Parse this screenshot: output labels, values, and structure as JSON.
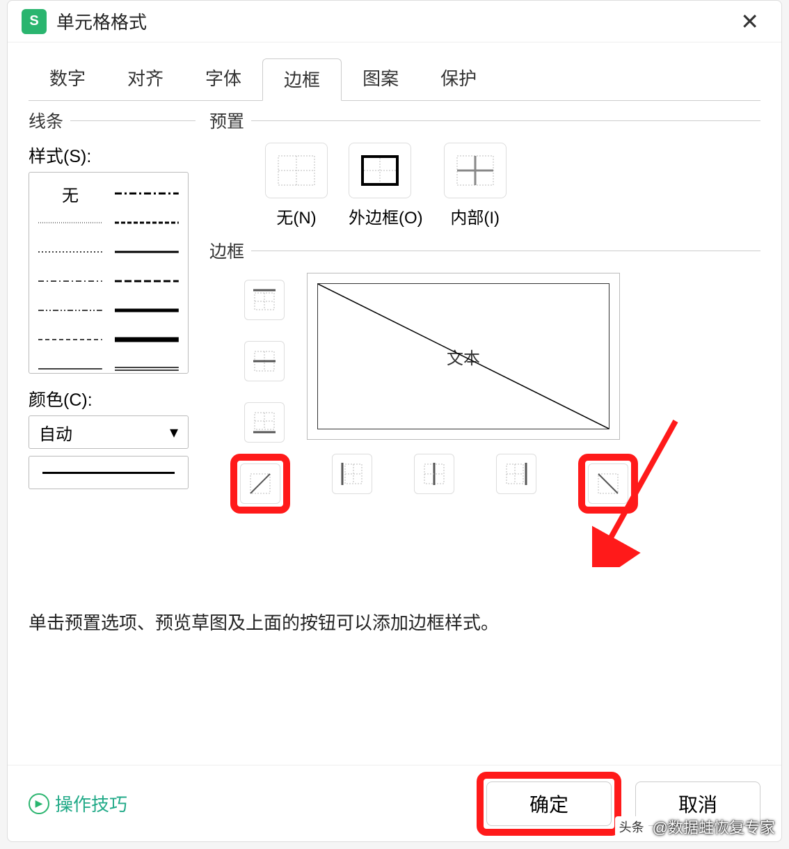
{
  "dialog": {
    "title": "单元格格式",
    "app_icon_letter": "S"
  },
  "tabs": [
    "数字",
    "对齐",
    "字体",
    "边框",
    "图案",
    "保护"
  ],
  "active_tab_index": 3,
  "line_group_label": "线条",
  "style_label": "样式(S):",
  "style_none_label": "无",
  "color_label": "颜色(C):",
  "color_value": "自动",
  "preset_group_label": "预置",
  "presets": [
    {
      "label": "无(N)"
    },
    {
      "label": "外边框(O)"
    },
    {
      "label": "内部(I)"
    }
  ],
  "border_group_label": "边框",
  "preview_text": "文本",
  "hint_text": "单击预置选项、预览草图及上面的按钮可以添加边框样式。",
  "tips_link": "操作技巧",
  "ok_button": "确定",
  "cancel_button": "取消",
  "watermark_badge": "头条",
  "watermark_text": "@数据蛙恢复专家"
}
